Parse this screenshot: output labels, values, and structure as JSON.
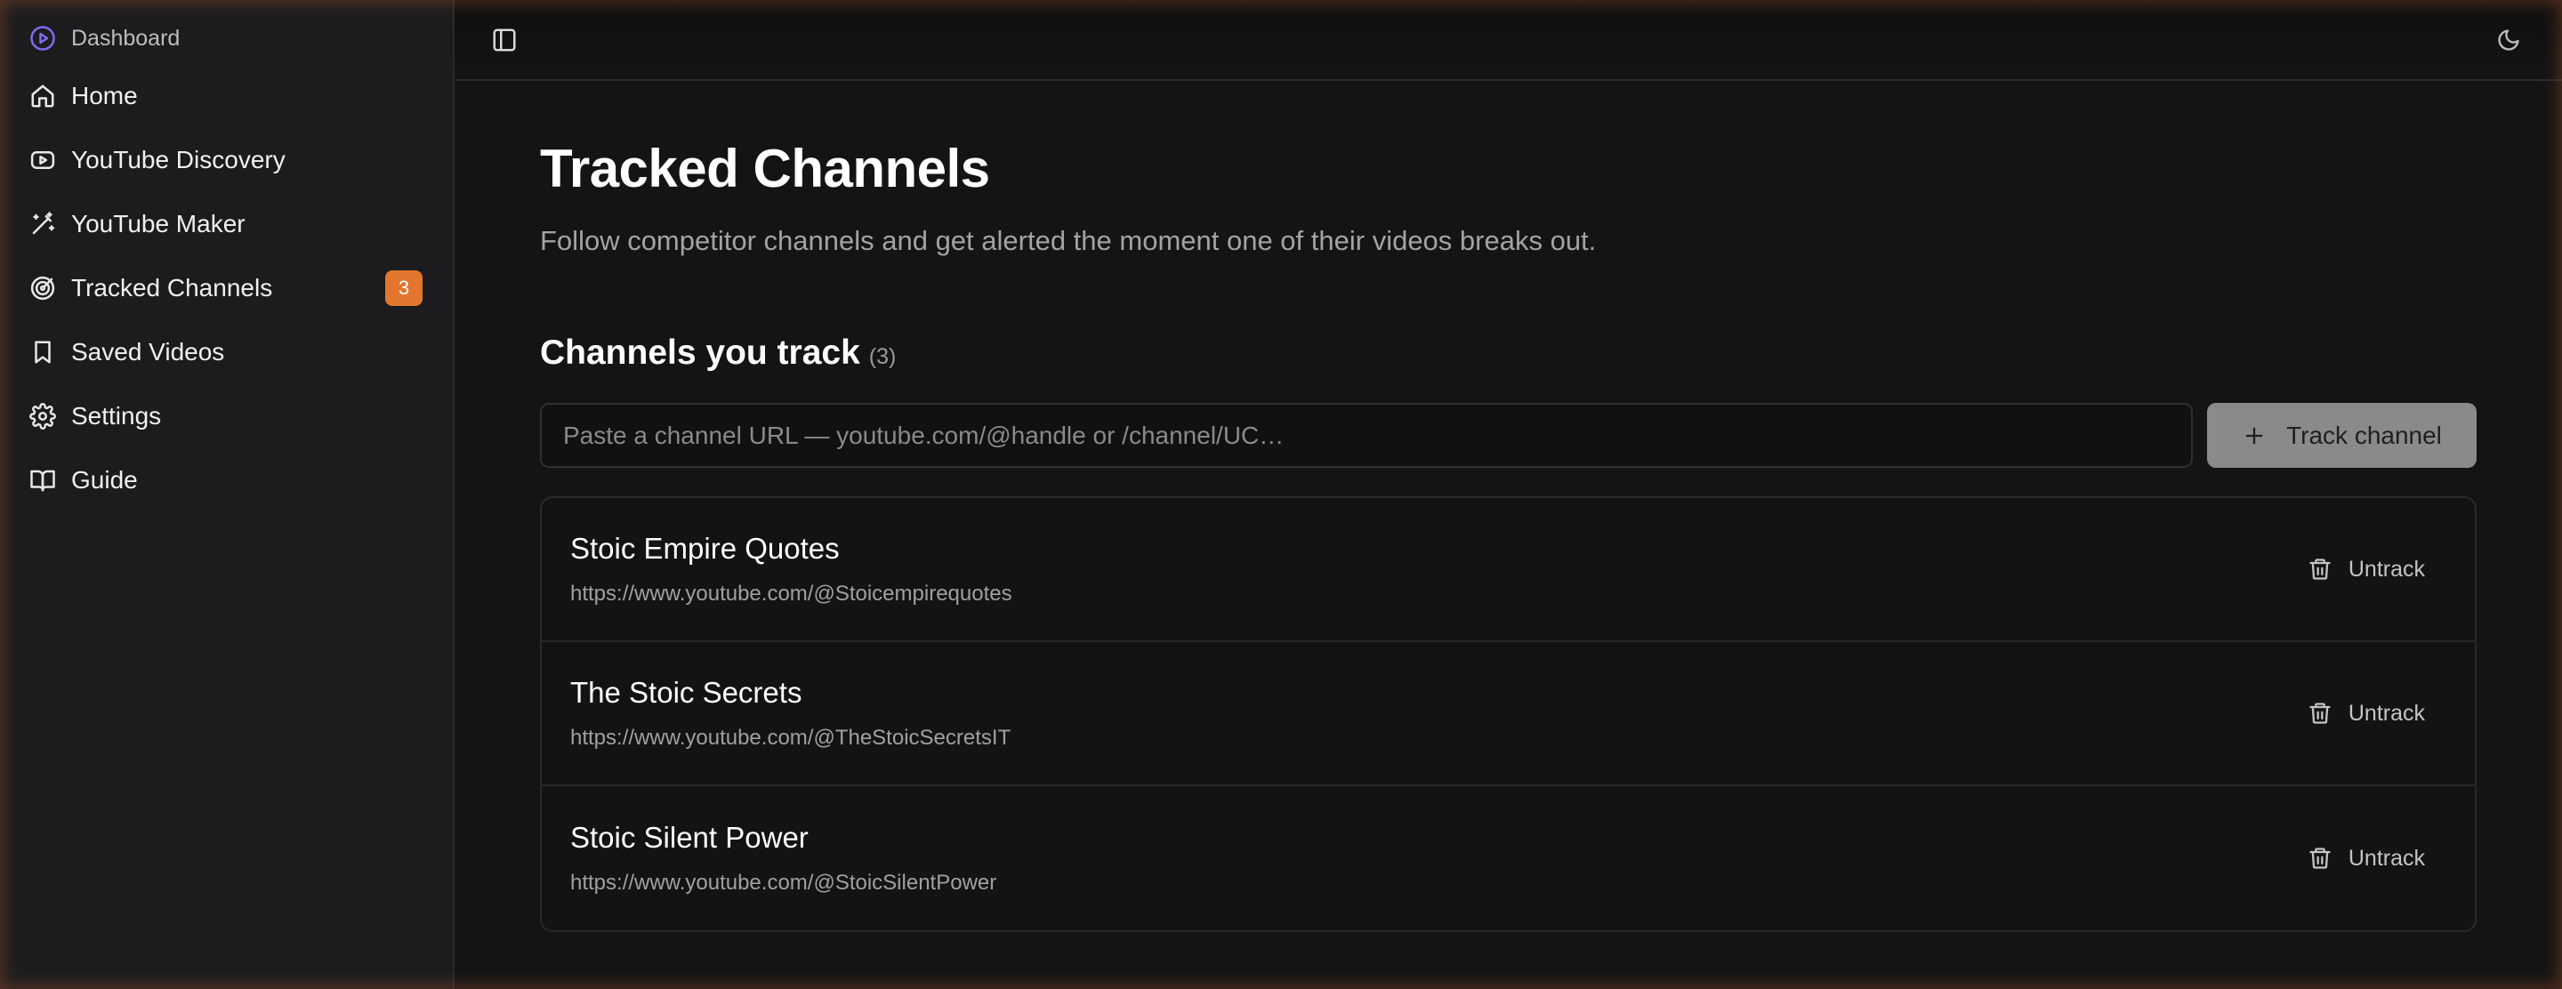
{
  "sidebar": {
    "brand": {
      "label": "Dashboard",
      "icon": "play-circle-icon"
    },
    "items": [
      {
        "label": "Home",
        "icon": "home-icon"
      },
      {
        "label": "YouTube Discovery",
        "icon": "youtube-icon"
      },
      {
        "label": "YouTube Maker",
        "icon": "magic-wand-icon"
      },
      {
        "label": "Tracked Channels",
        "icon": "target-icon",
        "badge": "3"
      },
      {
        "label": "Saved Videos",
        "icon": "bookmark-icon"
      },
      {
        "label": "Settings",
        "icon": "gear-icon"
      },
      {
        "label": "Guide",
        "icon": "book-open-icon"
      }
    ]
  },
  "header": {
    "sidebar_toggle_icon": "panel-left-icon",
    "theme_toggle_icon": "moon-icon"
  },
  "main": {
    "title": "Tracked Channels",
    "subtitle": "Follow competitor channels and get alerted the moment one of their videos breaks out.",
    "section_title": "Channels you track",
    "section_count": "(3)",
    "input_placeholder": "Paste a channel URL — youtube.com/@handle or /channel/UC…",
    "input_value": "",
    "track_button_label": "Track channel",
    "channels": [
      {
        "name": "Stoic Empire Quotes",
        "url": "https://www.youtube.com/@Stoicempirequotes",
        "action_label": "Untrack"
      },
      {
        "name": "The Stoic Secrets",
        "url": "https://www.youtube.com/@TheStoicSecretsIT",
        "action_label": "Untrack"
      },
      {
        "name": "Stoic Silent Power",
        "url": "https://www.youtube.com/@StoicSilentPower",
        "action_label": "Untrack"
      }
    ]
  },
  "colors": {
    "accent_badge": "#e2762e",
    "brand_icon": "#7c6cf0",
    "background": "#141414",
    "sidebar_background": "#1c1c1f",
    "track_button": "#8a8a8a"
  }
}
